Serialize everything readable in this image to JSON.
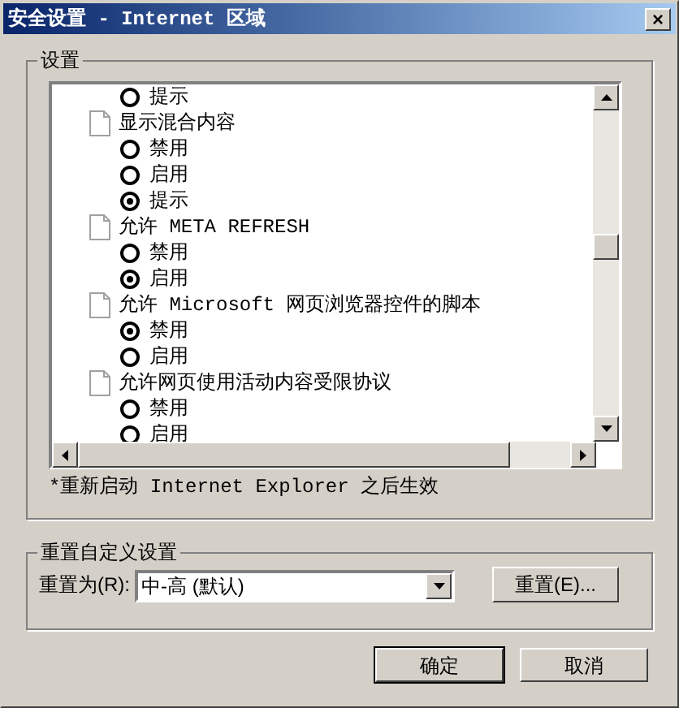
{
  "window": {
    "title": "安全设置 - Internet 区域",
    "close": "×"
  },
  "settings_group": {
    "title": "设置",
    "items": [
      {
        "kind": "option",
        "label": "提示",
        "selected": false
      },
      {
        "kind": "heading",
        "label": "显示混合内容",
        "children": [
          {
            "kind": "option",
            "label": "禁用",
            "selected": false
          },
          {
            "kind": "option",
            "label": "启用",
            "selected": false
          },
          {
            "kind": "option",
            "label": "提示",
            "selected": true
          }
        ]
      },
      {
        "kind": "heading",
        "label": "允许 META REFRESH",
        "children": [
          {
            "kind": "option",
            "label": "禁用",
            "selected": false
          },
          {
            "kind": "option",
            "label": "启用",
            "selected": true
          }
        ]
      },
      {
        "kind": "heading",
        "label": "允许 Microsoft 网页浏览器控件的脚本",
        "children": [
          {
            "kind": "option",
            "label": "禁用",
            "selected": true
          },
          {
            "kind": "option",
            "label": "启用",
            "selected": false
          }
        ]
      },
      {
        "kind": "heading",
        "label": "允许网页使用活动内容受限协议",
        "children": [
          {
            "kind": "option",
            "label": "禁用",
            "selected": false
          },
          {
            "kind": "option",
            "label": "启用",
            "selected": false
          }
        ]
      }
    ],
    "note": "*重新启动 Internet Explorer 之后生效"
  },
  "reset_group": {
    "title": "重置自定义设置",
    "label": "重置为(R):",
    "value": "中-高 (默认)",
    "button": "重置(E)..."
  },
  "buttons": [
    "确定",
    "取消"
  ]
}
